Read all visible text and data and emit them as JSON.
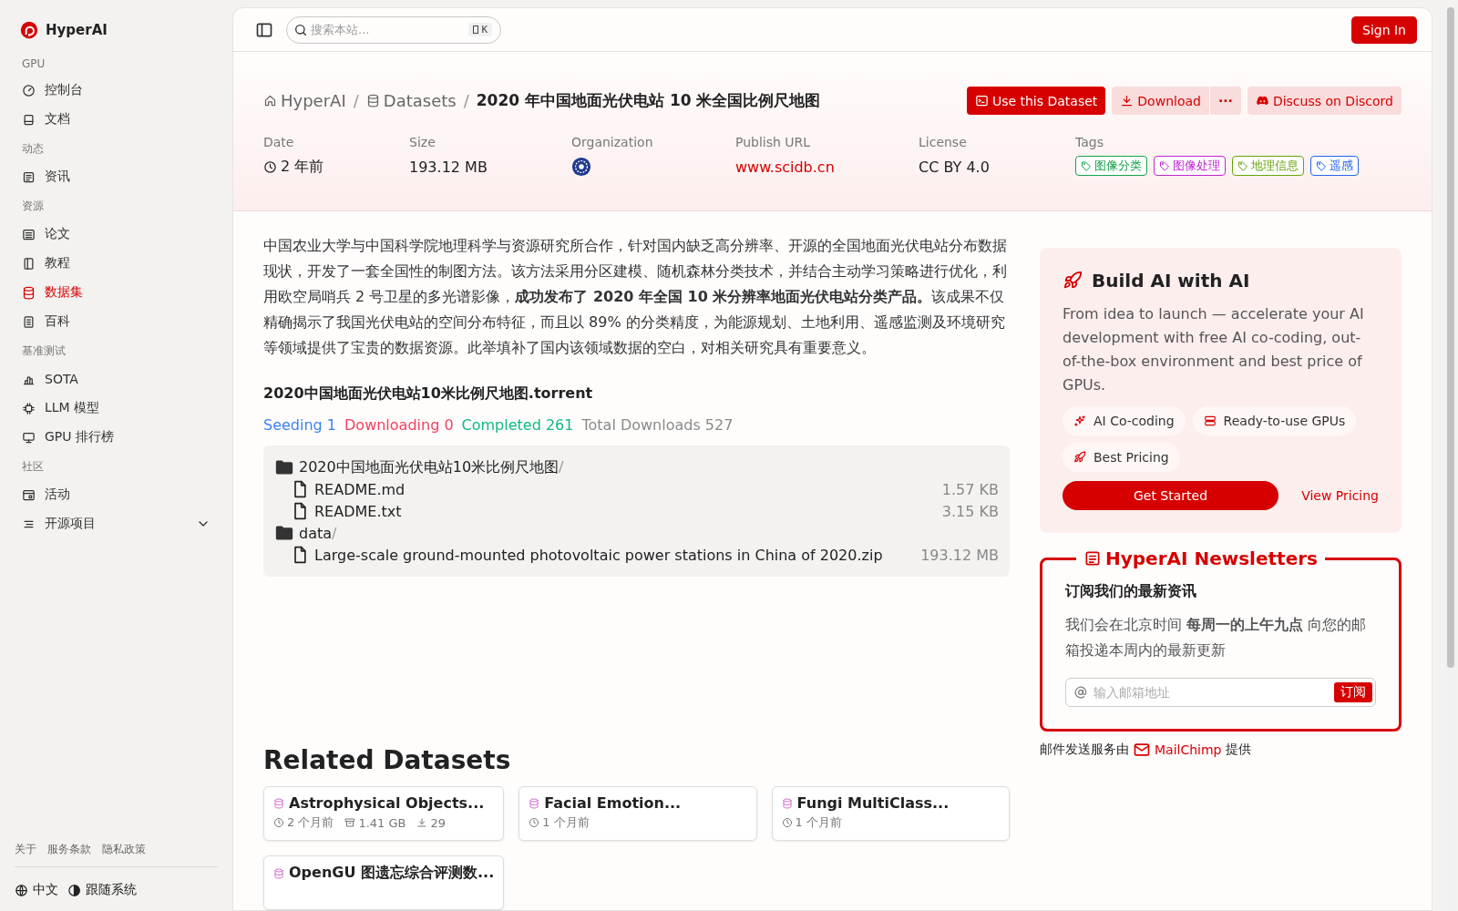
{
  "sidebar": {
    "logo": "HyperAI",
    "sections": [
      {
        "heading": "GPU",
        "items": [
          {
            "label": "控制台",
            "selected": false
          },
          {
            "label": "文档",
            "selected": false
          }
        ]
      },
      {
        "heading": "动态",
        "items": [
          {
            "label": "资讯",
            "selected": false
          }
        ]
      },
      {
        "heading": "资源",
        "items": [
          {
            "label": "论文",
            "selected": false
          },
          {
            "label": "教程",
            "selected": false
          },
          {
            "label": "数据集",
            "selected": true
          },
          {
            "label": "百科",
            "selected": false
          }
        ]
      },
      {
        "heading": "基准测试",
        "items": [
          {
            "label": "SOTA",
            "selected": false
          },
          {
            "label": "LLM 模型",
            "selected": false
          },
          {
            "label": "GPU 排行榜",
            "selected": false
          }
        ]
      },
      {
        "heading": "社区",
        "items": [
          {
            "label": "活动",
            "selected": false
          },
          {
            "label": "开源项目",
            "selected": false,
            "expanded": false
          }
        ]
      }
    ],
    "footer_links": [
      "关于",
      "服务条款",
      "隐私政策"
    ],
    "language": "中文",
    "theme": "跟随系统"
  },
  "header": {
    "search": {
      "placeholder": "搜索本站...",
      "shortcut": "K"
    },
    "sign_in": "Sign In"
  },
  "hero": {
    "separator": "/",
    "breadcrumb": [
      {
        "kind": "home",
        "label": "HyperAI"
      },
      {
        "kind": "section",
        "label": "Datasets"
      },
      {
        "kind": "current",
        "label": "2020 年中国地面光伏电站 10 米全国比例尺地图"
      }
    ],
    "actions": {
      "use": "Use this Dataset",
      "download": "Download",
      "more": "···",
      "discord": "Discuss on Discord"
    },
    "meta": [
      {
        "kind": "time",
        "label": "Date",
        "value": "2 年前"
      },
      {
        "kind": "text",
        "label": "Size",
        "value": "193.12 MB"
      },
      {
        "kind": "logo",
        "label": "Organization"
      },
      {
        "kind": "link",
        "label": "Publish URL",
        "value": "www.scidb.cn"
      },
      {
        "kind": "text",
        "label": "License",
        "value": "CC BY 4.0"
      },
      {
        "kind": "tags",
        "label": "Tags",
        "tags": [
          {
            "label": "图像分类",
            "color": "#16a34a"
          },
          {
            "label": "图像处理",
            "color": "#c026d3"
          },
          {
            "label": "地理信息",
            "color": "#65a30d"
          },
          {
            "label": "遥感",
            "color": "#2563eb"
          }
        ]
      }
    ]
  },
  "description": "中国农业大学与中国科学院地理科学与资源研究所合作，针对国内缺乏高分辨率、开源的全国地面光伏电站分布数据现状，开发了一套全国性的制图方法。该方法采用分区建模、随机森林分类技术，并结合主动学习策略进行优化，利用欧空局哨兵 2 号卫星的多光谱影像，**成功发布了 2020 年全国 10 米分辨率地面光伏电站分类产品。**该成果不仅精确揭示了我国光伏电站的空间分布特征，而且以 89% 的分类精度，为能源规划、土地利用、遥感监测及环境研究等领域提供了宝贵的数据资源。此举填补了国内该领域数据的空白，对相关研究具有重要意义。",
  "torrent": {
    "name": "2020中国地面光伏电站10米比例尺地图.torrent",
    "stats": [
      {
        "label": "Seeding 1",
        "color": "#3b82f6"
      },
      {
        "label": "Downloading 0",
        "color": "#f43f5e"
      },
      {
        "label": "Completed 261",
        "color": "#10b981"
      },
      {
        "label": "Total Downloads 527",
        "color": "#8a8a8a"
      }
    ],
    "files": [
      {
        "kind": "folder",
        "name": "2020中国地面光伏电站10米比例尺地图",
        "slash": "/",
        "children": [
          {
            "kind": "file",
            "name": "README.md",
            "size": "1.57 KB"
          },
          {
            "kind": "file",
            "name": "README.txt",
            "size": "3.15 KB"
          }
        ]
      },
      {
        "kind": "folder",
        "name": "data",
        "slash": "/",
        "children": [
          {
            "kind": "file",
            "name": "Large-scale ground-mounted photovoltaic power stations in China of 2020.zip",
            "size": "193.12 MB"
          }
        ]
      }
    ]
  },
  "related": {
    "title": "Related Datasets",
    "cards": [
      {
        "title": "Astrophysical Objects...",
        "meta": [
          {
            "kind": "time",
            "text": "2 个月前"
          },
          {
            "kind": "size",
            "text": "1.41 GB"
          },
          {
            "kind": "downloads",
            "text": "29"
          }
        ]
      },
      {
        "title": "Facial Emotion...",
        "meta": [
          {
            "kind": "time",
            "text": "1 个月前"
          }
        ]
      },
      {
        "title": "Fungi MultiClass...",
        "meta": [
          {
            "kind": "time",
            "text": "1 个月前"
          }
        ]
      },
      {
        "title": "OpenGU 图遗忘综合评测数..."
      }
    ]
  },
  "promo": {
    "title": "Build AI with AI",
    "body": "From idea to launch — accelerate your AI development with free AI co-coding, out-of-the-box environment and best price of GPUs.",
    "features": [
      "AI Co-coding",
      "Ready-to-use GPUs",
      "Best Pricing"
    ],
    "primary": "Get Started",
    "secondary": "View Pricing"
  },
  "newsletter": {
    "title": "HyperAI Newsletters",
    "subtitle": "订阅我们的最新资讯",
    "body": "我们会在北京时间 **每周一的上午九点** 向您的邮箱投递本周内的最新更新",
    "placeholder": "输入邮箱地址",
    "button": "订阅",
    "credit_before": "邮件发送服务由",
    "credit_link": "MailChimp",
    "credit_after": "提供"
  }
}
